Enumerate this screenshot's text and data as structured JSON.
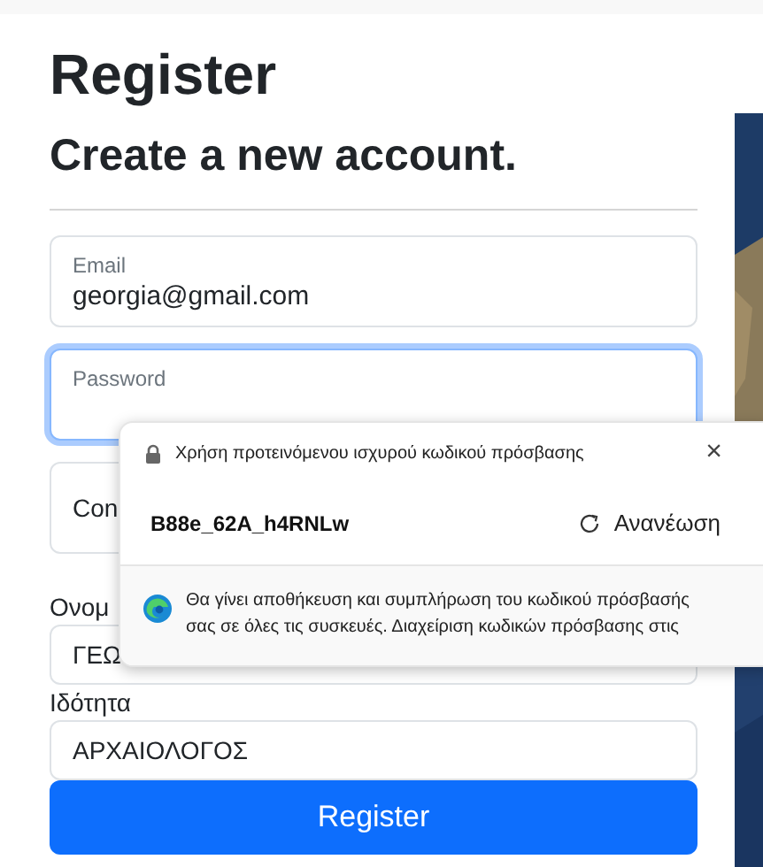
{
  "heading": "Register",
  "subheading": "Create a new account.",
  "fields": [
    {
      "kind": "floating",
      "label": "Email",
      "value": "georgia@gmail.com",
      "focused": false
    },
    {
      "kind": "floating",
      "label": "Password",
      "focused": true
    },
    {
      "kind": "plain",
      "value": "Con",
      "focused": false
    },
    {
      "kind": "labeled",
      "label": "Ονομ",
      "value": "ΓΕΩ",
      "focused": false
    },
    {
      "kind": "labeled",
      "label": "Ιδότητα",
      "value": "ΑΡΧΑΙΟΛΟΓΟΣ",
      "focused": false
    }
  ],
  "submit": "Register",
  "password_popup": {
    "title": "Χρήση προτεινόμενου ισχυρού κωδικού πρόσβασης",
    "close": "×",
    "suggested_password": "B88e_62A_h4RNLw",
    "refresh": "Ανανέωση",
    "note_lines": [
      "Θα γίνει αποθήκευση και συμπλήρωση του κωδικού πρόσβασής",
      "σας σε όλες τις συσκευές. Διαχείριση κωδικών πρόσβασης στις"
    ]
  }
}
